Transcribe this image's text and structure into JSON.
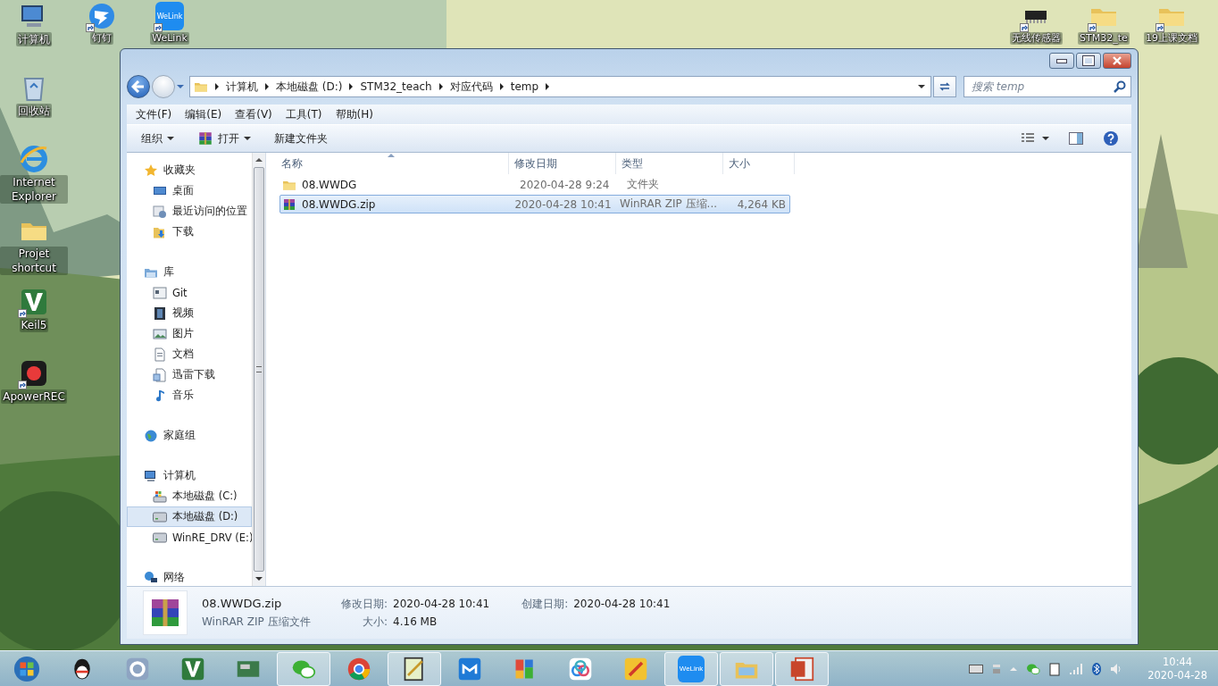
{
  "desktop": {
    "left": [
      {
        "label": "计算机",
        "kind": "computer",
        "shortcut": false
      },
      {
        "label": "回收站",
        "kind": "recycle",
        "shortcut": false
      },
      {
        "label": "Internet Explorer",
        "kind": "ie",
        "shortcut": false
      },
      {
        "label": "Projet shortcut",
        "kind": "folder",
        "shortcut": false
      },
      {
        "label": "Keil5",
        "kind": "keil",
        "shortcut": true
      },
      {
        "label": "ApowerREC",
        "kind": "recorder",
        "shortcut": true
      }
    ],
    "top": [
      {
        "label": "钉钉",
        "kind": "dingtalk",
        "shortcut": true
      },
      {
        "label": "WeLink",
        "kind": "welink",
        "logo": "WeLink",
        "shortcut": true
      }
    ],
    "right": [
      {
        "label": "无线传感器",
        "kind": "chip",
        "shortcut": true
      },
      {
        "label": "STM32_te",
        "kind": "folder",
        "shortcut": true
      },
      {
        "label": "19上课文档",
        "kind": "folder",
        "shortcut": true
      }
    ]
  },
  "window": {
    "address": [
      "计算机",
      "本地磁盘 (D:)",
      "STM32_teach",
      "对应代码",
      "temp"
    ],
    "search": {
      "placeholder": "搜索 temp"
    },
    "menu": [
      "文件(F)",
      "编辑(E)",
      "查看(V)",
      "工具(T)",
      "帮助(H)"
    ],
    "toolbar": [
      {
        "label": "组织",
        "kind": "dropdown"
      },
      {
        "label": "打开",
        "kind": "open"
      },
      {
        "label": "新建文件夹",
        "kind": "plain"
      }
    ],
    "nav": [
      {
        "label": "收藏夹",
        "kind": "star",
        "selected": false,
        "children": [
          {
            "label": "桌面",
            "kind": "desktop",
            "selected": false
          },
          {
            "label": "最近访问的位置",
            "kind": "recent",
            "selected": false
          },
          {
            "label": "下载",
            "kind": "download",
            "selected": false
          }
        ]
      },
      {
        "label": "库",
        "kind": "library",
        "selected": false,
        "children": [
          {
            "label": "Git",
            "kind": "git",
            "selected": false
          },
          {
            "label": "视频",
            "kind": "video",
            "selected": false
          },
          {
            "label": "图片",
            "kind": "picture",
            "selected": false
          },
          {
            "label": "文档",
            "kind": "document",
            "selected": false
          },
          {
            "label": "迅雷下载",
            "kind": "document2",
            "selected": false
          },
          {
            "label": "音乐",
            "kind": "music",
            "selected": false
          }
        ]
      },
      {
        "label": "家庭组",
        "kind": "homegroup",
        "selected": false
      },
      {
        "label": "计算机",
        "kind": "computer",
        "selected": false,
        "children": [
          {
            "label": "本地磁盘 (C:)",
            "kind": "drive-os",
            "selected": false
          },
          {
            "label": "本地磁盘 (D:)",
            "kind": "drive",
            "selected": true
          },
          {
            "label": "WinRE_DRV (E:)",
            "kind": "drive",
            "selected": false
          }
        ]
      },
      {
        "label": "网络",
        "kind": "network",
        "selected": false
      }
    ],
    "columns": [
      "名称",
      "修改日期",
      "类型",
      "大小"
    ],
    "rows": [
      {
        "name": "08.WWDG",
        "date": "2020-04-28 9:24",
        "type": "文件夹",
        "size": "",
        "kind": "folder",
        "selected": false
      },
      {
        "name": "08.WWDG.zip",
        "date": "2020-04-28 10:41",
        "type": "WinRAR ZIP 压缩...",
        "size": "4,264 KB",
        "kind": "zip",
        "selected": true
      }
    ],
    "details": {
      "name": "08.WWDG.zip",
      "type": "WinRAR ZIP 压缩文件",
      "modified_label": "修改日期:",
      "modified": "2020-04-28 10:41",
      "created_label": "创建日期:",
      "created": "2020-04-28 10:41",
      "size_label": "大小:",
      "size": "4.16 MB"
    }
  },
  "taskbar": {
    "apps": [
      {
        "kind": "qq",
        "running": false
      },
      {
        "kind": "gear",
        "running": false
      },
      {
        "kind": "keil",
        "running": false
      },
      {
        "kind": "board",
        "running": false
      },
      {
        "kind": "wechat",
        "running": true
      },
      {
        "kind": "chrome",
        "running": false
      },
      {
        "kind": "notepad",
        "running": true
      },
      {
        "kind": "maxthon",
        "running": false
      },
      {
        "kind": "blocks",
        "running": false
      },
      {
        "kind": "cloud",
        "running": false
      },
      {
        "kind": "pen",
        "running": false
      },
      {
        "kind": "welink",
        "logo": "WeLink",
        "running": true
      },
      {
        "kind": "explorer",
        "running": true
      },
      {
        "kind": "ppt",
        "running": true
      }
    ],
    "time": "10:44",
    "date": "2020-04-28"
  }
}
